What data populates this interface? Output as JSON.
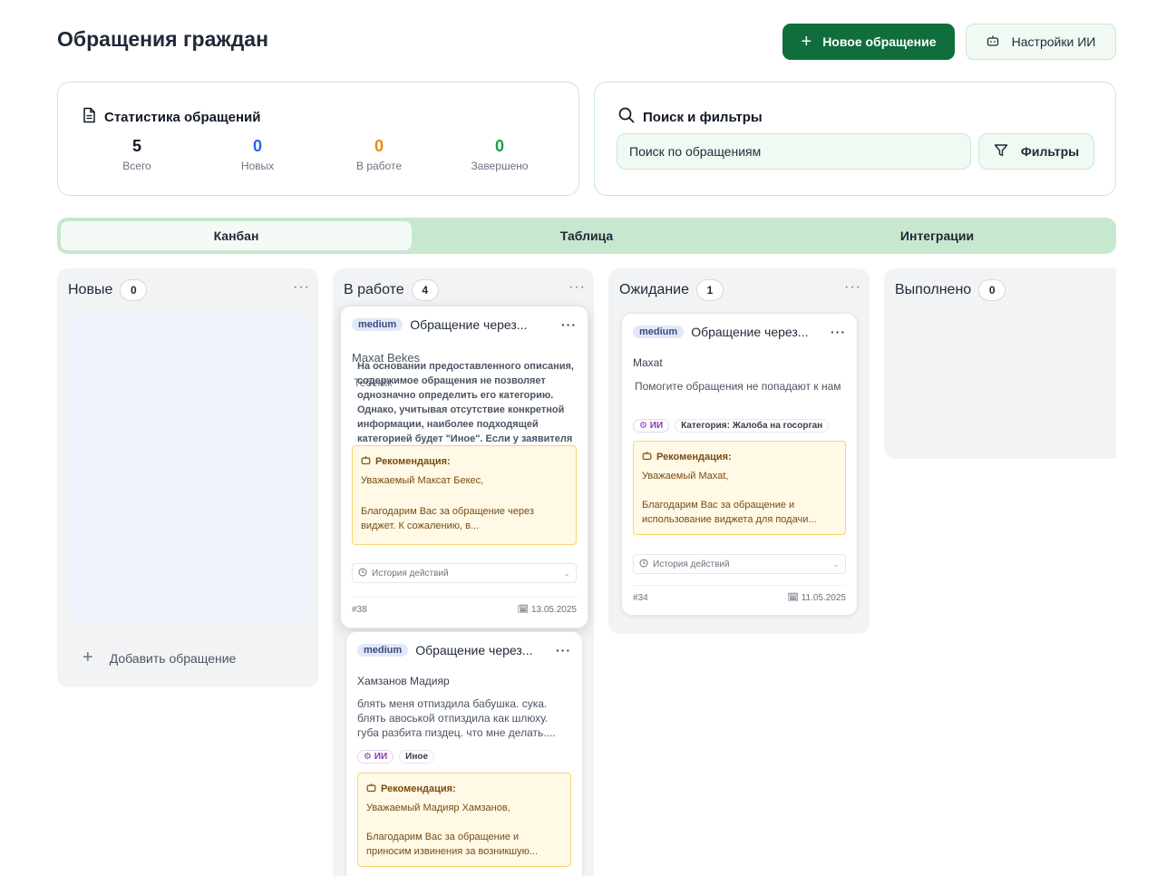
{
  "header": {
    "title": "Обращения граждан",
    "new_button": "Новое обращение",
    "ai_settings_button": "Настройки ИИ"
  },
  "stats": {
    "title": "Статистика обращений",
    "items": [
      {
        "value": "5",
        "label": "Всего",
        "color": "#111827"
      },
      {
        "value": "0",
        "label": "Новых",
        "color": "#2563eb"
      },
      {
        "value": "0",
        "label": "В работе",
        "color": "#ea8a0c"
      },
      {
        "value": "0",
        "label": "Завершено",
        "color": "#16a34a"
      }
    ]
  },
  "search": {
    "title": "Поиск и фильтры",
    "placeholder": "Поиск по обращениям",
    "filter_button": "Фильтры"
  },
  "tabs": [
    {
      "label": "Канбан",
      "active": true
    },
    {
      "label": "Таблица",
      "active": false
    },
    {
      "label": "Интеграции",
      "active": false
    }
  ],
  "columns": {
    "new": {
      "title": "Новые",
      "count": "0",
      "add_label": "Добавить обращение"
    },
    "in_progress": {
      "title": "В работе",
      "count": "4"
    },
    "waiting": {
      "title": "Ожидание",
      "count": "1"
    },
    "done": {
      "title": "Выполнено",
      "count": "0"
    }
  },
  "tickets": {
    "t38": {
      "priority": "medium",
      "title": "Обращение через...",
      "author": "Maxat Bekes",
      "ghost_text": "Тебеккк",
      "ai_overlay": "На основании предоставленного описания, содержимое обращения не позволяет однозначно определить его категорию. Однако, учитывая отсутствие конкретной информации, наиболее подходящей категорией будет \"Иное\". Если у заявителя",
      "rec_title": "Рекомендация:",
      "rec_greeting": "Уважаемый Максат Бекес,",
      "rec_body": "Благодарим Вас за обращение через виджет. К сожалению, в...",
      "history": "История действий",
      "id": "#38",
      "date": "13.05.2025"
    },
    "t_madiyar": {
      "priority": "medium",
      "title": "Обращение через...",
      "author": "Хамзанов Мадияр",
      "description": "блять меня отпиздила бабушка. сука. блять авоськой отпиздила как шлюху. губа разбита пиздец. что мне делать....",
      "tag_ai": "ИИ",
      "tag": "Иное",
      "rec_title": "Рекомендация:",
      "rec_greeting": "Уважаемый Мадияр Хамзанов,",
      "rec_body": "Благодарим Вас за обращение и приносим извинения за возникшую..."
    },
    "t34": {
      "priority": "medium",
      "title": "Обращение через...",
      "author": "Maxat",
      "description": "Помогите обращения не попадают к нам",
      "tag_ai": "ИИ",
      "tag": "Категория: Жалоба на госорган",
      "rec_title": "Рекомендация:",
      "rec_greeting": "Уважаемый Maxat,",
      "rec_body": "Благодарим Вас за обращение и использование виджета для подачи...",
      "history": "История действий",
      "id": "#34",
      "date": "11.05.2025"
    }
  }
}
